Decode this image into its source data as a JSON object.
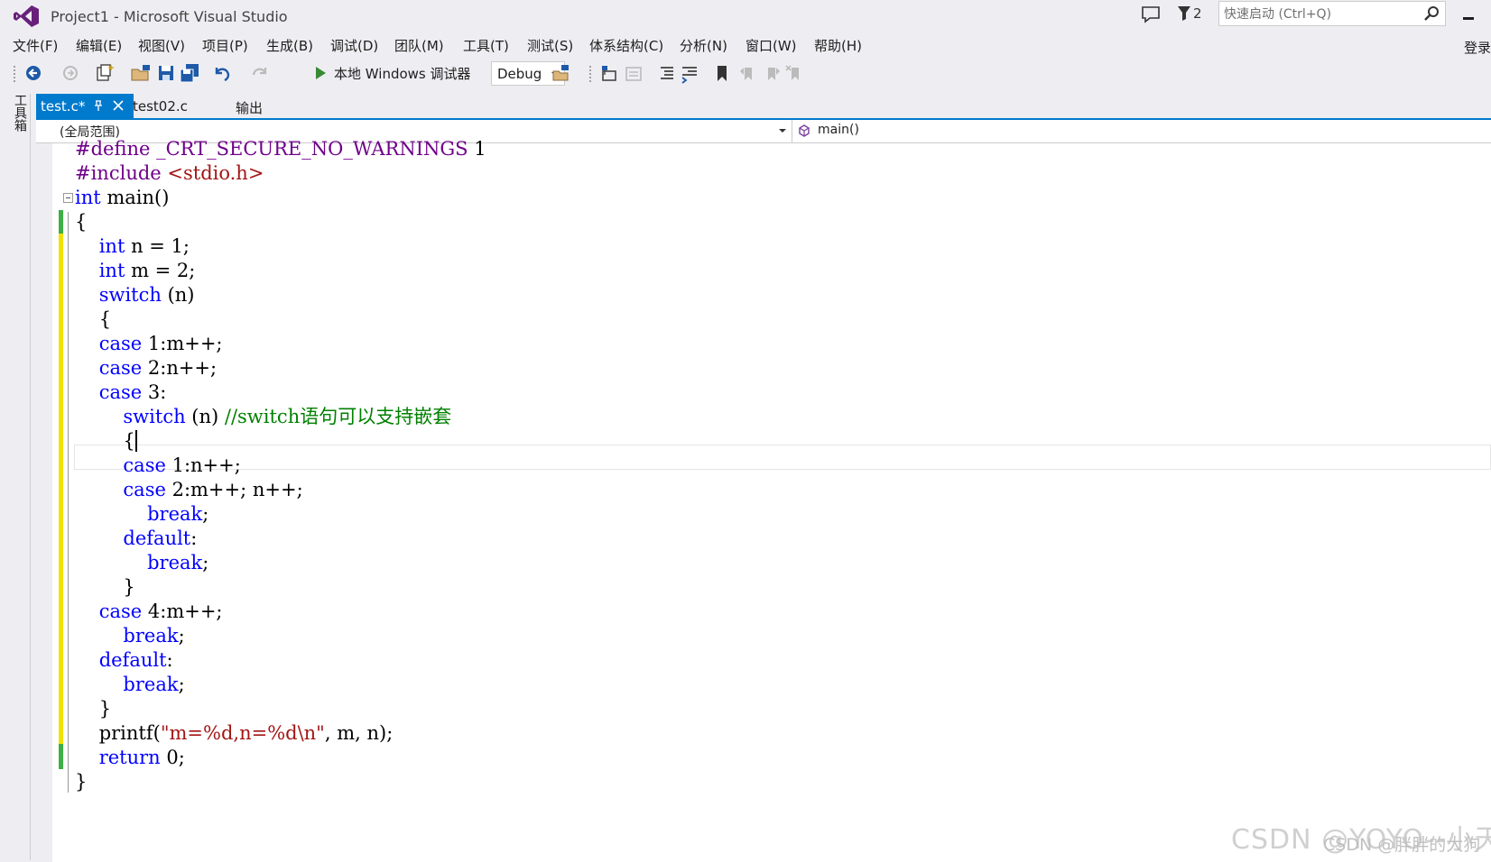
{
  "window": {
    "title": "Project1 - Microsoft Visual Studio",
    "notification_count": "2",
    "quick_launch_placeholder": "快速启动 (Ctrl+Q)",
    "login_label": "登录"
  },
  "menu": [
    {
      "label": "文件(F)"
    },
    {
      "label": "编辑(E)"
    },
    {
      "label": "视图(V)"
    },
    {
      "label": "项目(P)"
    },
    {
      "label": "生成(B)"
    },
    {
      "label": "调试(D)"
    },
    {
      "label": "团队(M)"
    },
    {
      "label": "工具(T)"
    },
    {
      "label": "测试(S)"
    },
    {
      "label": "体系结构(C)"
    },
    {
      "label": "分析(N)"
    },
    {
      "label": "窗口(W)"
    },
    {
      "label": "帮助(H)"
    }
  ],
  "toolbar": {
    "debugger_label": "本地 Windows 调试器",
    "configuration": "Debug"
  },
  "toolbox_tab": "工具箱",
  "tabs": {
    "active": "test.c*",
    "others": [
      "test02.c",
      "输出"
    ]
  },
  "navbar": {
    "scope": "(全局范围)",
    "function": "main()"
  },
  "code_lines": [
    "#define _CRT_SECURE_NO_WARNINGS 1",
    "#include <stdio.h>",
    "int main()",
    "{",
    "    int n = 1;",
    "    int m = 2;",
    "    switch (n)",
    "    {",
    "    case 1:m++;",
    "    case 2:n++;",
    "    case 3:",
    "        switch (n) //switch语句可以支持嵌套",
    "        {",
    "        case 1:n++;",
    "        case 2:m++; n++;",
    "            break;",
    "        default:",
    "            break;",
    "        }",
    "    case 4:m++;",
    "        break;",
    "    default:",
    "        break;",
    "    }",
    "    printf(\"m=%d,n=%d\\n\", m, n);",
    "    return 0;",
    "}"
  ],
  "watermark": "CSDN @YOYO--小天",
  "watermark_secondary": "CSDN @胖胖的大狗",
  "colors": {
    "accent": "#007acc",
    "keyword": "#0000ff",
    "preprocessor": "#6f008a",
    "string": "#a31515",
    "comment": "#008000",
    "saved_change": "#3cb043",
    "unsaved_change": "#f2e100"
  }
}
